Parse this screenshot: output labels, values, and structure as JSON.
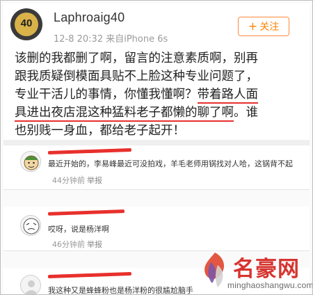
{
  "post": {
    "username": "Laphroaig40",
    "meta": "12-8 20:32  来自iPhone 6s",
    "avatar_text": "40",
    "follow_label": "关注",
    "follow_icon": "plus-icon",
    "lines": [
      "该删的我都删了啊，留言的注意素质啊，别再",
      "跟我质疑倒模面具贴不上脸这种专业问题了，",
      "专业干活儿的事情，你懂我懂啊？",
      "带着路人面",
      "具进出夜店混这种猛料老子都懒的聊了啊",
      "。谁",
      "也别贱一身血，都给老子起开！"
    ]
  },
  "comments": [
    {
      "text": "最近开始的，李易峰最近可没拍戏，羊毛老师用锅找对人哈，这锅背不起",
      "time": "44分钟前",
      "report": "举报"
    },
    {
      "text": "哎呀，说是杨洋啊",
      "time": "46分钟前",
      "report": "举报"
    },
    {
      "text": "我这种又是蜂蜂粉也是杨洋粉的很尴尬脑手",
      "time": "",
      "report": ""
    }
  ],
  "watermark": {
    "title": "名豪网",
    "url": "minghaoshangwu.com"
  },
  "colors": {
    "accent_orange": "#ff8200",
    "underline_red": "#e8302c",
    "watermark_red": "#d6342f"
  }
}
